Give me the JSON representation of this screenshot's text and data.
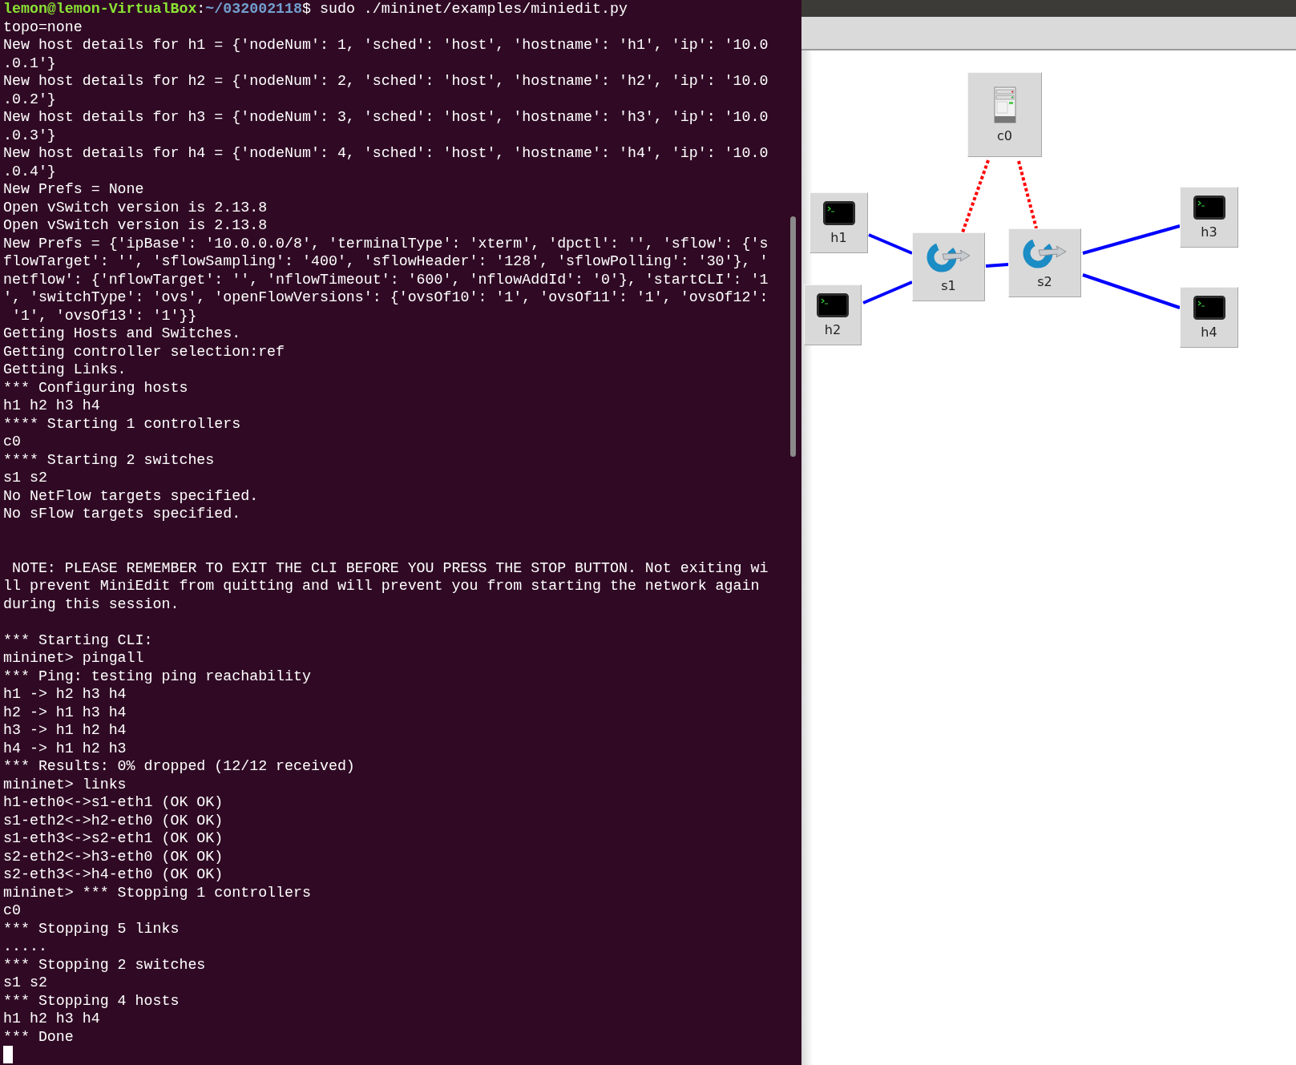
{
  "terminal": {
    "lines": [
      {
        "kind": "prompt",
        "user_host": "lemon@lemon-VirtualBox",
        "separator": ":",
        "path": "~/032002118",
        "command": "$ sudo ./mininet/examples/miniedit.py"
      },
      {
        "kind": "text",
        "text": "topo=none"
      },
      {
        "kind": "text",
        "text": "New host details for h1 = {'nodeNum': 1, 'sched': 'host', 'hostname': 'h1', 'ip': '10.0"
      },
      {
        "kind": "text",
        "text": ".0.1'}"
      },
      {
        "kind": "text",
        "text": "New host details for h2 = {'nodeNum': 2, 'sched': 'host', 'hostname': 'h2', 'ip': '10.0"
      },
      {
        "kind": "text",
        "text": ".0.2'}"
      },
      {
        "kind": "text",
        "text": "New host details for h3 = {'nodeNum': 3, 'sched': 'host', 'hostname': 'h3', 'ip': '10.0"
      },
      {
        "kind": "text",
        "text": ".0.3'}"
      },
      {
        "kind": "text",
        "text": "New host details for h4 = {'nodeNum': 4, 'sched': 'host', 'hostname': 'h4', 'ip': '10.0"
      },
      {
        "kind": "text",
        "text": ".0.4'}"
      },
      {
        "kind": "text",
        "text": "New Prefs = None"
      },
      {
        "kind": "text",
        "text": "Open vSwitch version is 2.13.8"
      },
      {
        "kind": "text",
        "text": "Open vSwitch version is 2.13.8"
      },
      {
        "kind": "text",
        "text": "New Prefs = {'ipBase': '10.0.0.0/8', 'terminalType': 'xterm', 'dpctl': '', 'sflow': {'s"
      },
      {
        "kind": "text",
        "text": "flowTarget': '', 'sflowSampling': '400', 'sflowHeader': '128', 'sflowPolling': '30'}, '"
      },
      {
        "kind": "text",
        "text": "netflow': {'nflowTarget': '', 'nflowTimeout': '600', 'nflowAddId': '0'}, 'startCLI': '1"
      },
      {
        "kind": "text",
        "text": "', 'switchType': 'ovs', 'openFlowVersions': {'ovsOf10': '1', 'ovsOf11': '1', 'ovsOf12':"
      },
      {
        "kind": "text",
        "text": " '1', 'ovsOf13': '1'}}"
      },
      {
        "kind": "text",
        "text": "Getting Hosts and Switches."
      },
      {
        "kind": "text",
        "text": "Getting controller selection:ref"
      },
      {
        "kind": "text",
        "text": "Getting Links."
      },
      {
        "kind": "text",
        "text": "*** Configuring hosts"
      },
      {
        "kind": "text",
        "text": "h1 h2 h3 h4"
      },
      {
        "kind": "text",
        "text": "**** Starting 1 controllers"
      },
      {
        "kind": "text",
        "text": "c0"
      },
      {
        "kind": "text",
        "text": "**** Starting 2 switches"
      },
      {
        "kind": "text",
        "text": "s1 s2"
      },
      {
        "kind": "text",
        "text": "No NetFlow targets specified."
      },
      {
        "kind": "text",
        "text": "No sFlow targets specified."
      },
      {
        "kind": "blank"
      },
      {
        "kind": "blank"
      },
      {
        "kind": "text",
        "text": " NOTE: PLEASE REMEMBER TO EXIT THE CLI BEFORE YOU PRESS THE STOP BUTTON. Not exiting wi"
      },
      {
        "kind": "text",
        "text": "ll prevent MiniEdit from quitting and will prevent you from starting the network again"
      },
      {
        "kind": "text",
        "text": "during this session."
      },
      {
        "kind": "blank"
      },
      {
        "kind": "text",
        "text": "*** Starting CLI:"
      },
      {
        "kind": "text",
        "text": "mininet> pingall"
      },
      {
        "kind": "text",
        "text": "*** Ping: testing ping reachability"
      },
      {
        "kind": "text",
        "text": "h1 -> h2 h3 h4"
      },
      {
        "kind": "text",
        "text": "h2 -> h1 h3 h4"
      },
      {
        "kind": "text",
        "text": "h3 -> h1 h2 h4"
      },
      {
        "kind": "text",
        "text": "h4 -> h1 h2 h3"
      },
      {
        "kind": "text",
        "text": "*** Results: 0% dropped (12/12 received)"
      },
      {
        "kind": "text",
        "text": "mininet> links"
      },
      {
        "kind": "text",
        "text": "h1-eth0<->s1-eth1 (OK OK)"
      },
      {
        "kind": "text",
        "text": "s1-eth2<->h2-eth0 (OK OK)"
      },
      {
        "kind": "text",
        "text": "s1-eth3<->s2-eth1 (OK OK)"
      },
      {
        "kind": "text",
        "text": "s2-eth2<->h3-eth0 (OK OK)"
      },
      {
        "kind": "text",
        "text": "s2-eth3<->h4-eth0 (OK OK)"
      },
      {
        "kind": "text",
        "text": "mininet> *** Stopping 1 controllers"
      },
      {
        "kind": "text",
        "text": "c0"
      },
      {
        "kind": "text",
        "text": "*** Stopping 5 links"
      },
      {
        "kind": "text",
        "text": "....."
      },
      {
        "kind": "text",
        "text": "*** Stopping 2 switches"
      },
      {
        "kind": "text",
        "text": "s1 s2"
      },
      {
        "kind": "text",
        "text": "*** Stopping 4 hosts"
      },
      {
        "kind": "text",
        "text": "h1 h2 h3 h4"
      },
      {
        "kind": "text",
        "text": "*** Done"
      },
      {
        "kind": "cursor"
      }
    ]
  },
  "miniedit": {
    "nodes": [
      {
        "kind": "controller",
        "label": "c0"
      },
      {
        "kind": "host",
        "label": "h1"
      },
      {
        "kind": "switch",
        "label": "s1"
      },
      {
        "kind": "switch",
        "label": "s2"
      },
      {
        "kind": "host",
        "label": "h3"
      },
      {
        "kind": "host",
        "label": "h2"
      },
      {
        "kind": "host",
        "label": "h4"
      }
    ],
    "links": [
      {
        "kind": "data"
      },
      {
        "kind": "data"
      },
      {
        "kind": "data"
      },
      {
        "kind": "data"
      },
      {
        "kind": "data"
      },
      {
        "kind": "control"
      },
      {
        "kind": "control"
      }
    ]
  }
}
